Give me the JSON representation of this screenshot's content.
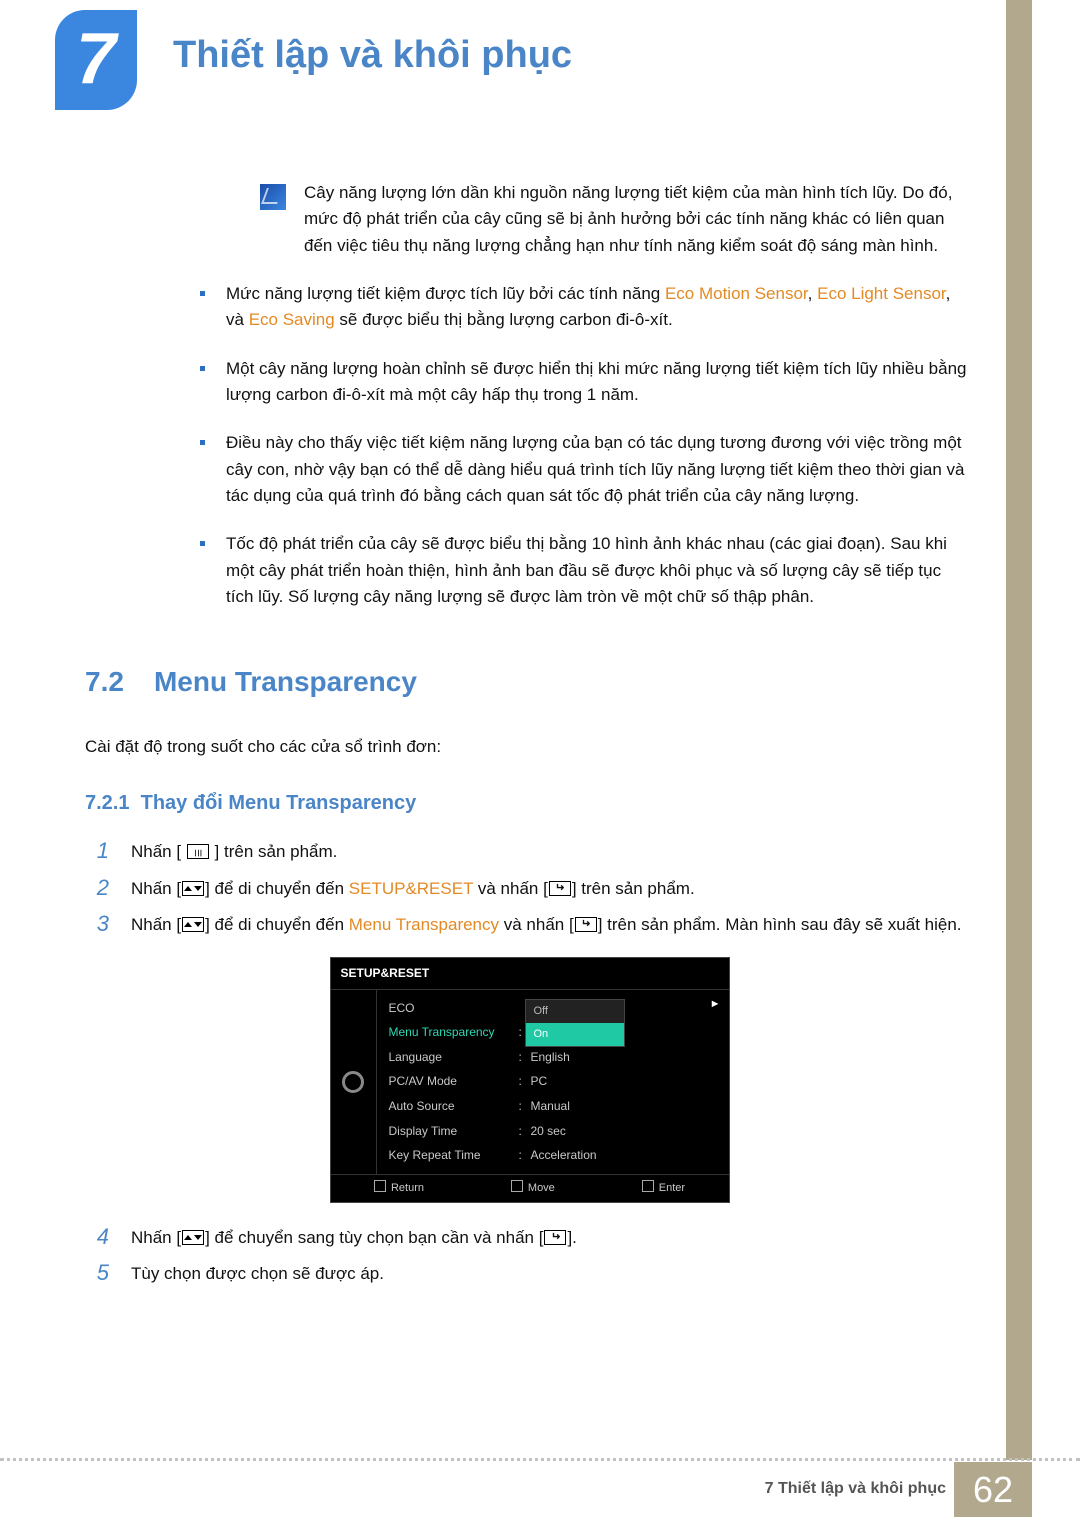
{
  "chapter": {
    "number": "7",
    "title": "Thiết lập và khôi phục"
  },
  "note_paragraph": "Cây năng lượng lớn dần khi nguồn năng lượng tiết kiệm của màn hình tích lũy. Do đó, mức độ phát triển của cây cũng sẽ bị ảnh hưởng bởi các tính năng khác có liên quan đến việc tiêu thụ năng lượng chẳng hạn như tính năng kiểm soát độ sáng màn hình.",
  "bullets": {
    "b1_pre": "Mức năng lượng tiết kiệm được tích lũy bởi các tính năng ",
    "b1_em1": "Eco Motion Sensor",
    "b1_sep1": ", ",
    "b1_em2": "Eco Light Sensor",
    "b1_sep2": ", và ",
    "b1_em3": "Eco Saving",
    "b1_post": " sẽ được biểu thị bằng lượng carbon đi-ô-xít.",
    "b2": "Một cây năng lượng hoàn chỉnh sẽ được hiển thị khi mức năng lượng tiết kiệm tích lũy nhiều bằng lượng carbon đi-ô-xít mà một cây hấp thụ trong 1 năm.",
    "b3": "Điều này cho thấy việc tiết kiệm năng lượng của bạn có tác dụng tương đương với việc trồng một cây con, nhờ vậy bạn có thể dễ dàng hiểu quá trình tích lũy năng lượng tiết kiệm theo thời gian và tác dụng của quá trình đó bằng cách quan sát tốc độ phát triển của cây năng lượng.",
    "b4": "Tốc độ phát triển của cây sẽ được biểu thị bằng 10 hình ảnh khác nhau (các giai đoạn). Sau khi một cây phát triển hoàn thiện, hình ảnh ban đầu sẽ được khôi phục và số lượng cây sẽ tiếp tục tích lũy. Số lượng cây năng lượng sẽ được làm tròn về một chữ số thập phân."
  },
  "section": {
    "number": "7.2",
    "title": "Menu Transparency"
  },
  "section_intro": "Cài đặt độ trong suốt cho các cửa sổ trình đơn:",
  "subsection": {
    "number": "7.2.1",
    "title": "Thay đổi Menu Transparency"
  },
  "steps": {
    "s1_pre": "Nhấn [ ",
    "s1_post": " ] trên sản phẩm.",
    "s2_pre": "Nhấn [",
    "s2_mid1": "] để di chuyển đến ",
    "s2_em": "SETUP&RESET",
    "s2_mid2": " và nhấn [",
    "s2_post": "] trên sản phẩm.",
    "s3_pre": "Nhấn [",
    "s3_mid1": "] để di chuyển đến ",
    "s3_em": "Menu Transparency",
    "s3_mid2": " và nhấn [",
    "s3_post": "] trên sản phẩm. Màn hình sau đây sẽ xuất hiện.",
    "s4_pre": "Nhấn [",
    "s4_mid": "] để chuyển sang tùy chọn bạn cần và nhấn [",
    "s4_post": "].",
    "s5": "Tùy chọn được chọn sẽ được áp."
  },
  "osd": {
    "title": "SETUP&RESET",
    "rows": {
      "eco": "ECO",
      "menu_transparency": "Menu Transparency",
      "language": "Language",
      "language_val": "English",
      "pcav": "PC/AV Mode",
      "pcav_val": "PC",
      "autosrc": "Auto Source",
      "autosrc_val": "Manual",
      "disptime": "Display Time",
      "disptime_val": "20 sec",
      "keyrep": "Key Repeat Time",
      "keyrep_val": "Acceleration"
    },
    "arrow": "►",
    "popup": {
      "off": "Off",
      "on": "On"
    },
    "bottom": {
      "return": "Return",
      "move": "Move",
      "enter": "Enter"
    }
  },
  "footer": {
    "chapter": "7 Thiết lập và khôi phục",
    "page": "62"
  }
}
